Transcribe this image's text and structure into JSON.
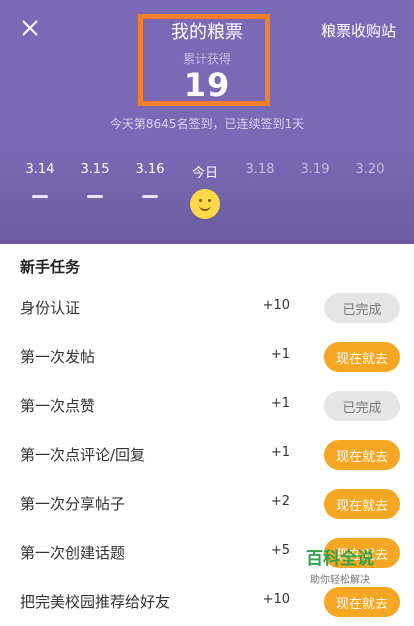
{
  "header": {
    "title": "我的粮票",
    "right_link": "粮票收购站",
    "stat_label": "累计获得",
    "stat_value": "19",
    "summary": "今天第8645名签到，已连续签到1天",
    "bg_color": "#7a6ab6"
  },
  "calendar": {
    "days": [
      "3.14",
      "3.15",
      "3.16",
      "今日",
      "3.18",
      "3.19",
      "3.20"
    ]
  },
  "tasks": {
    "title": "新手任务",
    "items": [
      {
        "name": "身份认证",
        "points": "+10",
        "action": "已完成"
      },
      {
        "name": "第一次发帖",
        "points": "+1",
        "action": "现在就去"
      },
      {
        "name": "第一次点赞",
        "points": "+1",
        "action": "已完成"
      },
      {
        "name": "第一次点评论/回复",
        "points": "+1",
        "action": "现在就去"
      },
      {
        "name": "第一次分享帖子",
        "points": "+2",
        "action": "现在就去"
      },
      {
        "name": "第一次创建话题",
        "points": "+5",
        "action": "现在就去"
      },
      {
        "name": "把完美校园推荐给好友",
        "points": "+10",
        "action": "现在就去"
      }
    ]
  },
  "watermark": {
    "line1": "百科全说",
    "line2": "助你轻松解决"
  },
  "colors": {
    "accent_orange": "#f5a623",
    "highlight_box": "#f47f2a"
  }
}
